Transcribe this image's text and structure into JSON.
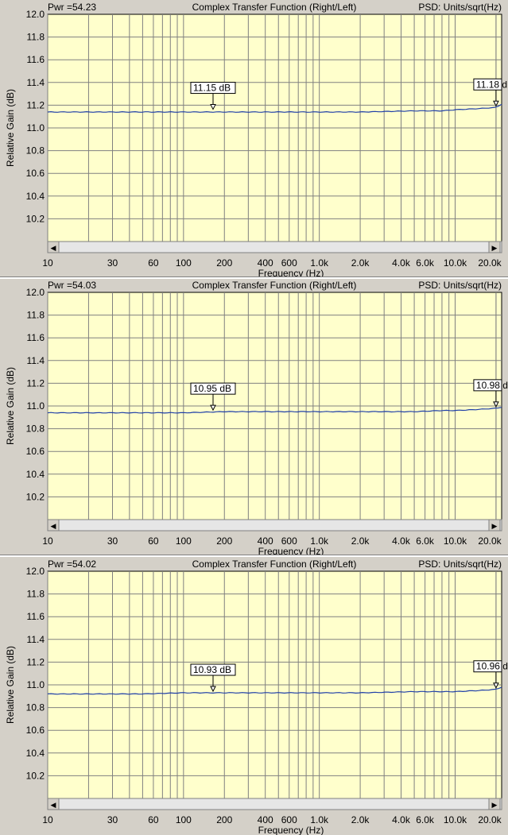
{
  "chart_data": [
    {
      "type": "line",
      "header_left": "Pwr =54.23",
      "title": "Complex Transfer Function (Right/Left)",
      "header_right": "PSD: Units/sqrt(Hz)",
      "xlabel": "Frequency (Hz)",
      "ylabel": "Relative Gain (dB)",
      "x_scale": "log",
      "xlim": [
        10,
        22000
      ],
      "ylim": [
        10.0,
        12.0
      ],
      "grid": true,
      "y_ticks": [
        "12.0",
        "11.8",
        "11.6",
        "11.4",
        "11.2",
        "11.0",
        "10.8",
        "10.6",
        "10.4",
        "10.2"
      ],
      "x_ticks": [
        "10",
        "30",
        "60",
        "100",
        "200",
        "400",
        "600",
        "1.0k",
        "2.0k",
        "4.0k",
        "6.0k",
        "10.0k",
        "20.0k"
      ],
      "series": [
        {
          "x": [
            10,
            20,
            50,
            100,
            200,
            500,
            1000,
            2000,
            5000,
            8000,
            10000,
            15000,
            20000,
            22000
          ],
          "y": [
            11.14,
            11.14,
            11.14,
            11.14,
            11.14,
            11.14,
            11.14,
            11.14,
            11.15,
            11.15,
            11.16,
            11.17,
            11.18,
            11.21
          ]
        }
      ],
      "markers": [
        {
          "x": 165,
          "y": 11.15,
          "label": "11.15 dB"
        },
        {
          "x": 20000,
          "y": 11.18,
          "label": "11.18 d"
        }
      ]
    },
    {
      "type": "line",
      "header_left": "Pwr =54.03",
      "title": "Complex Transfer Function (Right/Left)",
      "header_right": "PSD: Units/sqrt(Hz)",
      "xlabel": "Frequency (Hz)",
      "ylabel": "Relative Gain (dB)",
      "x_scale": "log",
      "xlim": [
        10,
        22000
      ],
      "ylim": [
        10.0,
        12.0
      ],
      "grid": true,
      "y_ticks": [
        "12.0",
        "11.8",
        "11.6",
        "11.4",
        "11.2",
        "11.0",
        "10.8",
        "10.6",
        "10.4",
        "10.2"
      ],
      "x_ticks": [
        "10",
        "30",
        "60",
        "100",
        "200",
        "400",
        "600",
        "1.0k",
        "2.0k",
        "4.0k",
        "6.0k",
        "10.0k",
        "20.0k"
      ],
      "series": [
        {
          "x": [
            10,
            20,
            50,
            100,
            200,
            500,
            1000,
            2000,
            5000,
            8000,
            10000,
            15000,
            20000,
            22000
          ],
          "y": [
            10.94,
            10.94,
            10.94,
            10.94,
            10.95,
            10.95,
            10.95,
            10.95,
            10.95,
            10.96,
            10.96,
            10.97,
            10.98,
            10.99
          ]
        }
      ],
      "markers": [
        {
          "x": 165,
          "y": 10.95,
          "label": "10.95 dB"
        },
        {
          "x": 20000,
          "y": 10.98,
          "label": "10.98 d"
        }
      ]
    },
    {
      "type": "line",
      "header_left": "Pwr =54.02",
      "title": "Complex Transfer Function (Right/Left)",
      "header_right": "PSD: Units/sqrt(Hz)",
      "xlabel": "Frequency (Hz)",
      "ylabel": "Relative Gain (dB)",
      "x_scale": "log",
      "xlim": [
        10,
        22000
      ],
      "ylim": [
        10.0,
        12.0
      ],
      "grid": true,
      "y_ticks": [
        "12.0",
        "11.8",
        "11.6",
        "11.4",
        "11.2",
        "11.0",
        "10.8",
        "10.6",
        "10.4",
        "10.2"
      ],
      "x_ticks": [
        "10",
        "30",
        "60",
        "100",
        "200",
        "400",
        "600",
        "1.0k",
        "2.0k",
        "4.0k",
        "6.0k",
        "10.0k",
        "20.0k"
      ],
      "series": [
        {
          "x": [
            10,
            20,
            50,
            100,
            200,
            500,
            1000,
            2000,
            5000,
            8000,
            10000,
            15000,
            20000,
            22000
          ],
          "y": [
            10.92,
            10.92,
            10.92,
            10.93,
            10.93,
            10.93,
            10.93,
            10.93,
            10.94,
            10.94,
            10.94,
            10.95,
            10.96,
            10.98
          ]
        }
      ],
      "markers": [
        {
          "x": 165,
          "y": 10.93,
          "label": "10.93 dB"
        },
        {
          "x": 20000,
          "y": 10.96,
          "label": "10.96 d"
        }
      ]
    }
  ],
  "colors": {
    "plot_bg": "#ffffcc",
    "frame_bg": "#d4d0c8",
    "grid": "#808080",
    "trace": "#1f3fa8",
    "scrollbar_track": "#e6e6e6"
  },
  "scrollbar": {
    "left_arrow": "◀",
    "right_arrow": "▶"
  }
}
